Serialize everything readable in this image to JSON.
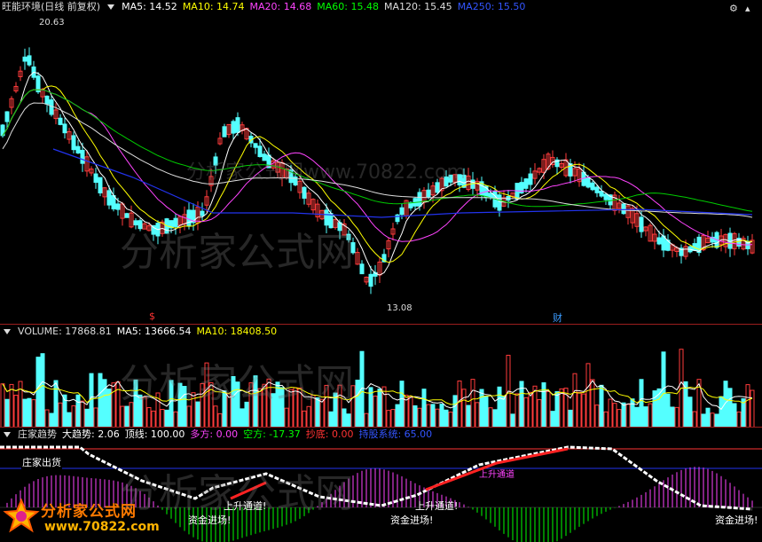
{
  "main": {
    "title": "旺能环境(日线 前复权)",
    "ma": [
      {
        "label": "MA5: 14.52",
        "color": "#ffffff"
      },
      {
        "label": "MA10: 14.74",
        "color": "#ffff00"
      },
      {
        "label": "MA20: 14.68",
        "color": "#ff44ff"
      },
      {
        "label": "MA60: 15.48",
        "color": "#00ff00"
      },
      {
        "label": "MA120: 15.45",
        "color": "#dddddd"
      },
      {
        "label": "MA250: 15.50",
        "color": "#3355ff"
      }
    ],
    "high_label": "20.63",
    "low_label": "13.08",
    "marker_s": "$",
    "marker_cai": "财",
    "watermark_url": "分析家公式网www.70822.com",
    "watermark_big": "分析家公式网"
  },
  "volume": {
    "title": "VOLUME: 17868.81",
    "ma5": "MA5: 13666.54",
    "ma10": "MA10: 18408.50",
    "watermark": "分析家公式网"
  },
  "indicator": {
    "name": "庄家趋势",
    "items": [
      {
        "label": "大趋势: 2.06",
        "color": "#ffffff"
      },
      {
        "label": "顶线: 100.00",
        "color": "#ffffff"
      },
      {
        "label": "多方: 0.00",
        "color": "#ff44ff"
      },
      {
        "label": "空方: -17.37",
        "color": "#00ff00"
      },
      {
        "label": "抄底: 0.00",
        "color": "#ff3333"
      },
      {
        "label": "持股系统: 65.00",
        "color": "#3355ff"
      }
    ],
    "tag_out": "庄家出货",
    "tag_up1": "上升通道!",
    "tag_up2": "上升通道!",
    "tag_in1": "资金进场!",
    "tag_in2": "资金进场!",
    "tag_in3": "资金进场!",
    "tag_mid": "上升通道",
    "watermark": "分析家公式网"
  },
  "logo": {
    "text": "分析家公式网",
    "url": "www.70822.com"
  },
  "colors": {
    "up": "#ff3b3b",
    "down": "#54ffff",
    "separator": "#9b1d1d"
  }
}
